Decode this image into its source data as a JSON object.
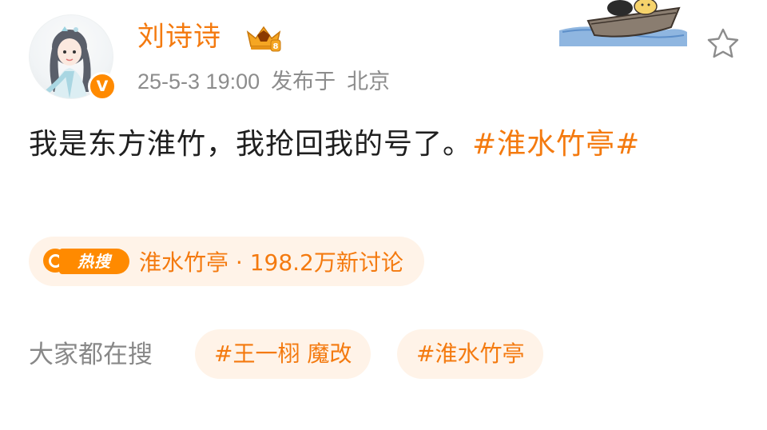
{
  "post": {
    "username": "刘诗诗",
    "timestamp": "25-5-3 19:00",
    "location_prefix": "发布于",
    "location": "北京",
    "text_plain": "我是东方淮竹，我抢回我的号了。",
    "hashtag": "#淮水竹亭#"
  },
  "trending": {
    "badge_label": "热搜",
    "text": "淮水竹亭 · 198.2万新讨论"
  },
  "search": {
    "label": "大家都在搜",
    "chips": [
      "#王一栩 魔改",
      "#淮水竹亭"
    ]
  },
  "icons": {
    "verified": "verified-v-badge-icon",
    "vip": "vip-crown-icon",
    "favorite": "star-outline-icon"
  },
  "colors": {
    "accent": "#f47a0f",
    "pill_bg": "#fff3e8",
    "text": "#1f1f1f",
    "muted": "#8c8c8c"
  }
}
